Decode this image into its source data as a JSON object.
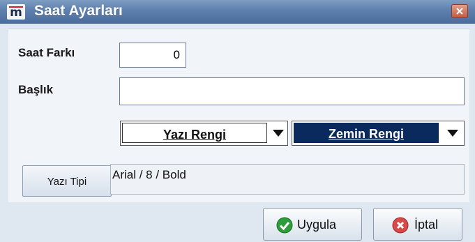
{
  "window": {
    "title": "Saat Ayarları",
    "logo_letter": "m",
    "close_icon": "close-x"
  },
  "form": {
    "time_offset_label": "Saat Farkı",
    "time_offset_value": "0",
    "title_label": "Başlık",
    "title_value": ""
  },
  "colors": {
    "text_color_label": "Yazı Rengi",
    "text_color_swatch": "#ffffff",
    "background_color_label": "Zemin Rengi",
    "background_color_swatch": "#0a2a5e"
  },
  "font": {
    "button_label": "Yazı Tipi",
    "current_font": "Arial / 8 / Bold"
  },
  "footer": {
    "apply_label": "Uygula",
    "apply_icon": "green-check",
    "cancel_label": "İptal",
    "cancel_icon": "red-x"
  }
}
